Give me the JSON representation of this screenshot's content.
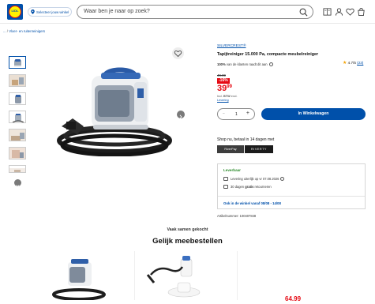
{
  "header": {
    "logo_text": "LIDL",
    "store_link": "Selecteer jouw winkel",
    "search_placeholder": "Waar ben je naar op zoek?"
  },
  "breadcrumb": {
    "prefix": "...",
    "separator": "/",
    "item": "Vloer- en ruitenreinigers"
  },
  "product": {
    "brand": "SILVERCREST®",
    "title": "Tapijtreiniger 15.000 Pa, compacte meubelreiniger",
    "recommend_pct": "100%",
    "recommend_text": "van de klanten raadt dit aan",
    "rating": "4.7/5",
    "rating_count": "(23)",
    "old_price": "49.99",
    "discount": "-16%",
    "price_main": "39",
    "price_cents": "99",
    "incl_text": "Incl.",
    "btw": "BTW",
    "excl_text": "excl.",
    "shipping_link": "Levering",
    "quantity": "1",
    "add_to_cart": "In Winkelwagen",
    "pay_later": "Shop nu, betaal in 14 dagen met",
    "pay_option_1": "RiverPay",
    "pay_option_2": "RIVERTY",
    "availability": "Leverbaar",
    "delivery_text": "Levering uiterlijk op vr 07.08.2026",
    "return_prefix": "30 dagen",
    "return_bold": "gratis",
    "return_suffix": "retourneren",
    "store_availability": "Ook in de winkel vanaf 08/08 - 14/08",
    "article_number": "Artikelnummer: 100407848"
  },
  "recommendations": {
    "subtitle": "Vaak samen gekocht",
    "title": "Gelijk meebestellen",
    "partial_price": "64.99"
  },
  "colors": {
    "brand_blue": "#0050aa",
    "price_red": "#e60a14",
    "available_green": "#2a8a2a"
  }
}
